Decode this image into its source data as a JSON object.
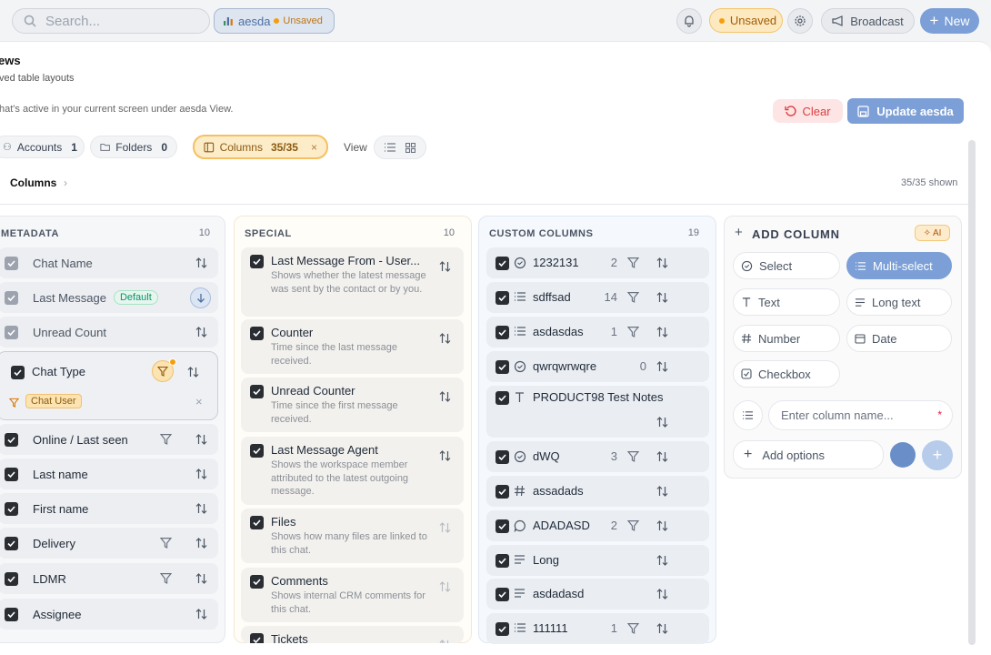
{
  "topbar": {
    "search_placeholder": "Search...",
    "view_name": "aesda",
    "view_status": "Unsaved",
    "unsaved_badge": "Unsaved",
    "broadcast_label": "Broadcast",
    "new_label": "New"
  },
  "page": {
    "title": "ews",
    "subtitle": "ved table layouts",
    "description": "hat's active in your current screen under aesda View.",
    "clear_label": "Clear",
    "update_label": "Update aesda"
  },
  "filters": {
    "accounts_label": "Accounts",
    "accounts_count": "1",
    "folders_label": "Folders",
    "folders_count": "0",
    "columns_label": "Columns",
    "columns_count": "35/35",
    "view_label": "View"
  },
  "breadcrumb": {
    "label": "Columns",
    "shown": "35/35 shown"
  },
  "metadata": {
    "heading": "METADATA",
    "count": "10",
    "items": [
      {
        "label": "Chat Name"
      },
      {
        "label": "Last Message",
        "badge": "Default"
      },
      {
        "label": "Unread Count"
      },
      {
        "label": "Chat Type",
        "filter_value": "Chat User"
      },
      {
        "label": "Online / Last seen"
      },
      {
        "label": "Last name"
      },
      {
        "label": "First name"
      },
      {
        "label": "Delivery"
      },
      {
        "label": "LDMR"
      },
      {
        "label": "Assignee"
      }
    ]
  },
  "special": {
    "heading": "SPECIAL",
    "count": "10",
    "items": [
      {
        "title": "Last Message From - User...",
        "desc": "Shows whether the latest message was sent by the contact or by you."
      },
      {
        "title": "Counter",
        "desc": "Time since the last message received."
      },
      {
        "title": "Unread Counter",
        "desc": "Time since the first message received."
      },
      {
        "title": "Last Message Agent",
        "desc": "Shows the workspace member attributed to the latest outgoing message."
      },
      {
        "title": "Files",
        "desc": "Shows how many files are linked to this chat."
      },
      {
        "title": "Comments",
        "desc": "Shows internal CRM comments for this chat."
      },
      {
        "title": "Tickets",
        "desc": ""
      }
    ]
  },
  "custom": {
    "heading": "CUSTOM COLUMNS",
    "count": "19",
    "items": [
      {
        "name": "1232131",
        "count": "2",
        "icon": "select-icon"
      },
      {
        "name": "sdffsad",
        "count": "14",
        "icon": "list-icon"
      },
      {
        "name": "asdasdas",
        "count": "1",
        "icon": "list-icon"
      },
      {
        "name": "qwrqwrwqre",
        "count": "0",
        "icon": "select-icon"
      },
      {
        "name": "PRODUCT98 Test Notes",
        "count": "",
        "icon": "text-icon"
      },
      {
        "name": "dWQ",
        "count": "3",
        "icon": "select-icon"
      },
      {
        "name": "assadads",
        "count": "",
        "icon": "hash-icon"
      },
      {
        "name": "ADADASD",
        "count": "2",
        "icon": "comment-icon"
      },
      {
        "name": "Long",
        "count": "",
        "icon": "longtext-icon"
      },
      {
        "name": "asdadasd",
        "count": "",
        "icon": "longtext-icon"
      },
      {
        "name": "111111",
        "count": "1",
        "icon": "list-icon"
      }
    ]
  },
  "add_column": {
    "heading": "ADD COLUMN",
    "ai_label": "AI",
    "types": [
      "Select",
      "Multi-select",
      "Text",
      "Long text",
      "Number",
      "Date",
      "Checkbox"
    ],
    "name_placeholder": "Enter column name...",
    "required_mark": "*",
    "add_options_label": "Add options",
    "accent_color": "#7b9fd6"
  }
}
